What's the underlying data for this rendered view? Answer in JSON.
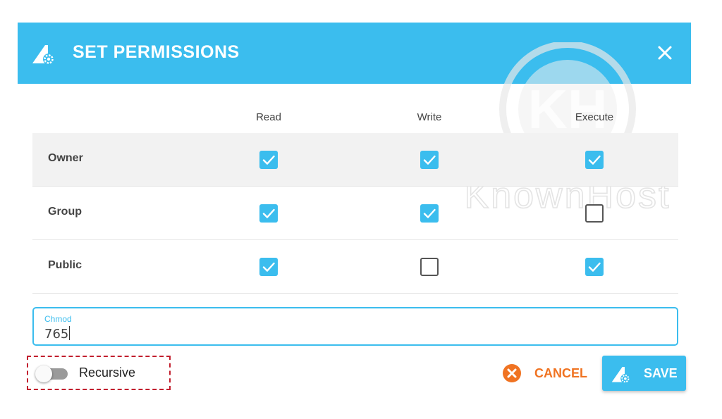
{
  "dialog": {
    "title": "SET PERMISSIONS",
    "logo_icon": "knownhost-gear-logo-icon",
    "close_icon": "close-icon"
  },
  "watermark": {
    "brand": "KnownHost",
    "monogram": "KH"
  },
  "table": {
    "columns": [
      "Read",
      "Write",
      "Execute"
    ],
    "rows": [
      {
        "label": "Owner",
        "read": true,
        "write": true,
        "execute": true
      },
      {
        "label": "Group",
        "read": true,
        "write": true,
        "execute": false
      },
      {
        "label": "Public",
        "read": true,
        "write": false,
        "execute": true
      }
    ]
  },
  "chmod": {
    "label": "Chmod",
    "value": "765"
  },
  "recursive": {
    "label": "Recursive",
    "enabled": false
  },
  "buttons": {
    "cancel_label": "CANCEL",
    "save_label": "SAVE"
  },
  "colors": {
    "accent": "#3bbdee",
    "cancel": "#f07322",
    "highlight_border": "#c21f2e"
  }
}
